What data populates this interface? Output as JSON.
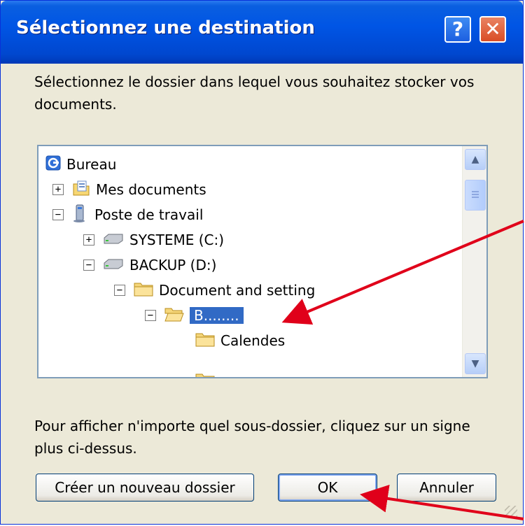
{
  "dialog": {
    "title": "Sélectionnez une destination",
    "help_glyph": "?",
    "close_glyph": "✕",
    "description": "Sélectionnez le dossier dans lequel vous souhaitez stocker vos documents.",
    "hint": "Pour afficher n'importe quel sous-dossier, cliquez sur un signe plus ci-dessus."
  },
  "tree": {
    "items": [
      {
        "label": "Bureau",
        "icon": "desktop-icon",
        "expander": ""
      },
      {
        "label": "Mes documents",
        "icon": "documents-folder-icon",
        "expander": "+"
      },
      {
        "label": "Poste de travail",
        "icon": "computer-icon",
        "expander": "−"
      },
      {
        "label": "SYSTEME (C:)",
        "icon": "drive-icon",
        "expander": "+"
      },
      {
        "label": "BACKUP (D:)",
        "icon": "drive-icon",
        "expander": "−"
      },
      {
        "label": "Document and setting",
        "icon": "folder-icon",
        "expander": "−"
      },
      {
        "label": "B........",
        "icon": "open-folder-icon",
        "expander": "−",
        "selected": true
      },
      {
        "label": "Calendes",
        "icon": "folder-icon",
        "expander": ""
      }
    ]
  },
  "buttons": {
    "new_folder": "Créer un nouveau dossier",
    "ok": "OK",
    "cancel": "Annuler"
  },
  "colors": {
    "titlebar": "#0055E5",
    "dialog_bg": "#ECE9D8",
    "selection": "#316AC5",
    "annotation_arrow": "#E0001A"
  }
}
